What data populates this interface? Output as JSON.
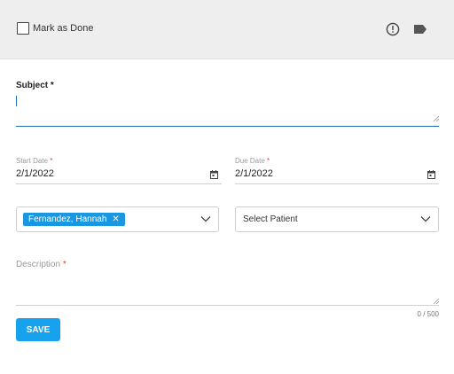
{
  "header": {
    "mark_done_label": "Mark as Done",
    "alert_icon": "exclamation-circle-icon",
    "tag_icon": "tag-icon"
  },
  "subject": {
    "label": "Subject",
    "required_mark": "*",
    "value": ""
  },
  "start_date": {
    "label": "Start Date",
    "required_mark": "*",
    "value": "2/1/2022"
  },
  "due_date": {
    "label": "Due Date",
    "required_mark": "*",
    "value": "2/1/2022"
  },
  "assignee": {
    "chips": [
      "Fernandez, Hannah"
    ],
    "remove_glyph": "✕"
  },
  "patient": {
    "placeholder": "Select Patient"
  },
  "description": {
    "label": "Description",
    "required_mark": "*",
    "counter": "0 / 500"
  },
  "actions": {
    "save_label": "SAVE"
  },
  "colors": {
    "accent": "#16a2ec",
    "chip": "#1997e0",
    "required": "#e53935",
    "focus_underline": "#1f6fb2"
  }
}
